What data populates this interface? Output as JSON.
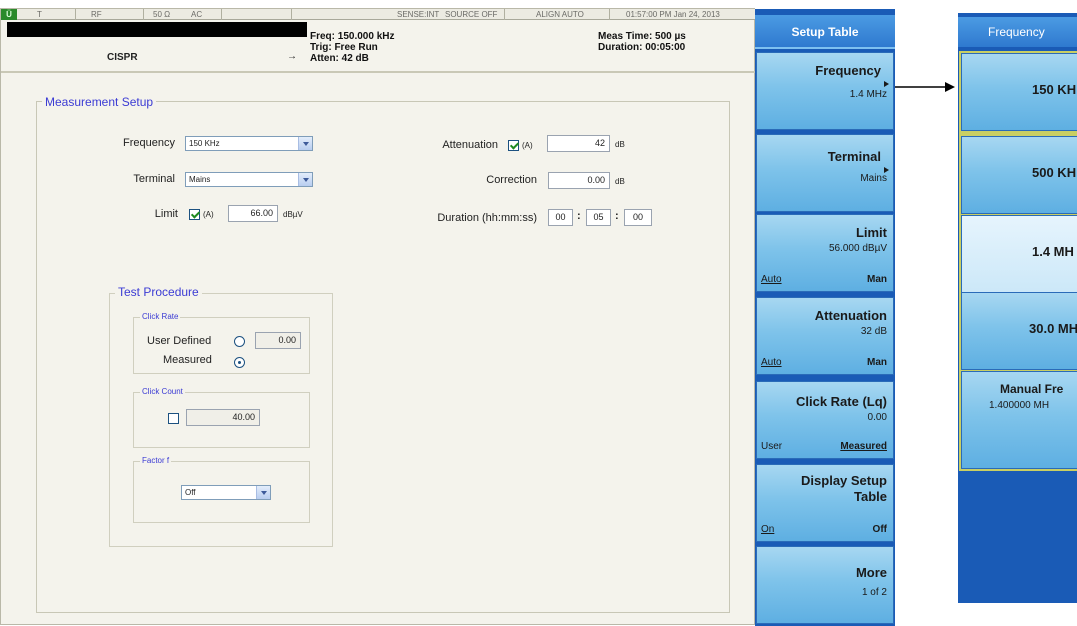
{
  "status_bar": {
    "mode": "T",
    "rf": "RF",
    "impedance": "50 Ω",
    "coupling": "AC",
    "sense": "SENSE:INT",
    "source": "SOURCE OFF",
    "align": "ALIGN AUTO",
    "datetime": "01:57:00 PM Jan 24, 2013",
    "logo": "Ü"
  },
  "header": {
    "mode_label": "CISPR",
    "freq": "Freq: 150.000 kHz",
    "trig": "Trig: Free Run",
    "atten": "Atten: 42 dB",
    "meas_time": "Meas Time: 500 µs",
    "duration": "Duration: 00:05:00",
    "arrow": "→"
  },
  "measurement_setup": {
    "title": "Measurement Setup",
    "frequency_label": "Frequency",
    "frequency_value": "150 KHz",
    "terminal_label": "Terminal",
    "terminal_value": "Mains",
    "limit_label": "Limit",
    "limit_auto": "(A)",
    "limit_value": "66.00",
    "limit_unit": "dBµV",
    "attenuation_label": "Attenuation",
    "attenuation_auto": "(A)",
    "attenuation_value": "42",
    "attenuation_unit": "dB",
    "correction_label": "Correction",
    "correction_value": "0.00",
    "correction_unit": "dB",
    "duration_label": "Duration (hh:mm:ss)",
    "duration_hh": "00",
    "duration_mm": "05",
    "duration_ss": "00",
    "colon": ":"
  },
  "test_procedure": {
    "title": "Test Procedure",
    "click_rate": {
      "title": "Click Rate",
      "user_defined_label": "User Defined",
      "user_defined_value": "0.00",
      "measured_label": "Measured",
      "selected": "Measured"
    },
    "click_count": {
      "title": "Click Count",
      "value": "40.00",
      "checked": false
    },
    "factor": {
      "title": "Factor f",
      "value": "Off"
    }
  },
  "soft_menu": {
    "title": "Setup Table",
    "keys": [
      {
        "label": "Frequency",
        "value": "1.4 MHz",
        "has_submenu": true
      },
      {
        "label": "Terminal",
        "value": "Mains",
        "has_submenu": true
      },
      {
        "label": "Limit",
        "value": "56.000 dBµV",
        "left": "Auto",
        "right": "Man"
      },
      {
        "label": "Attenuation",
        "value": "32 dB",
        "left": "Auto",
        "right": "Man"
      },
      {
        "label": "Click Rate (Lq)",
        "value": "0.00",
        "left": "User",
        "right": "Measured"
      },
      {
        "label": "Display Setup",
        "label2": "Table",
        "left": "On",
        "right": "Off"
      },
      {
        "label": "More",
        "value": "1 of 2"
      }
    ]
  },
  "frequency_menu": {
    "title": "Frequency",
    "options": [
      "150 KH",
      "500 KH",
      "1.4 MH",
      "30.0 MH"
    ],
    "selected": "1.4 MH",
    "manual_label": "Manual Fre",
    "manual_value": "1.400000 MH"
  },
  "colors": {
    "softkey_blue": "#5eafe2",
    "menu_bg": "#1a5bb6",
    "group_title": "#3b3bd4",
    "highlight_border": "#c9cf63"
  }
}
